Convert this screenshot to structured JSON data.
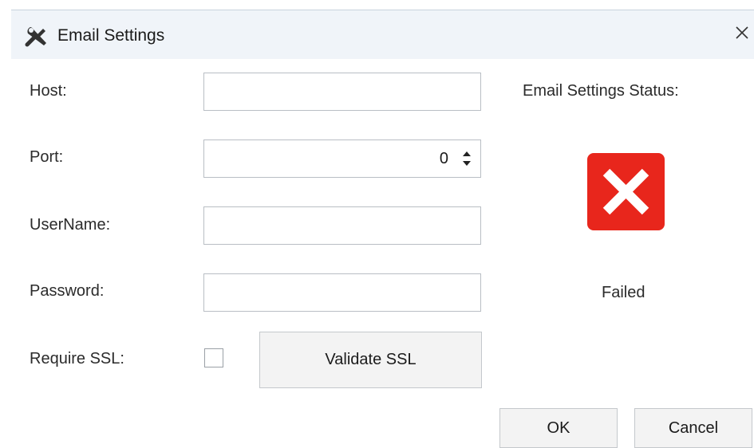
{
  "window": {
    "title": "Email Settings",
    "title_icon": "wrench-screwdriver-icon",
    "close_icon": "close-icon"
  },
  "form": {
    "host_label": "Host:",
    "host_value": "",
    "port_label": "Port:",
    "port_value": "0",
    "username_label": "UserName:",
    "username_value": "",
    "password_label": "Password:",
    "password_value": "",
    "ssl_label": "Require SSL:",
    "ssl_checked": false,
    "validate_ssl_label": "Validate SSL"
  },
  "status": {
    "title": "Email Settings Status:",
    "icon": "error-x-icon",
    "icon_color": "#e8261c",
    "text": "Failed"
  },
  "buttons": {
    "ok_label": "OK",
    "cancel_label": "Cancel"
  }
}
